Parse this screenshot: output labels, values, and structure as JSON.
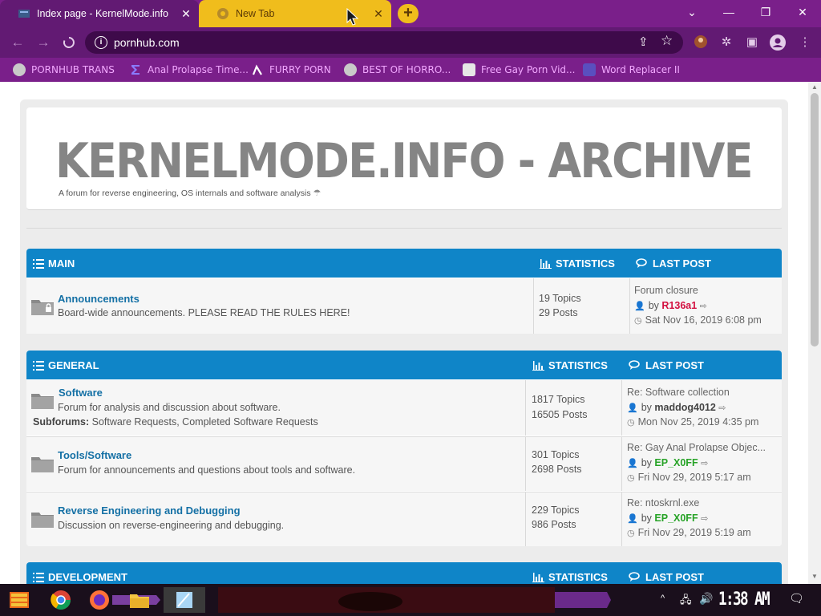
{
  "browser": {
    "tabs": [
      {
        "title": "Index page - KernelMode.info",
        "active": true
      },
      {
        "title": "New Tab",
        "active": false
      }
    ],
    "new_tab": "+",
    "window_controls": {
      "tab_search": "⌄",
      "minimize": "—",
      "restore": "❐",
      "close": "✕"
    },
    "url": "pornhub.com",
    "bookmarks": [
      "PORNHUB TRANS",
      "Anal Prolapse Time...",
      "FURRY PORN",
      "BEST OF HORRO...",
      "Free Gay Porn Vid...",
      "Word Replacer II"
    ],
    "colors": {
      "tabstrip": "#7a1f8a",
      "toolbar": "#621a73",
      "inactive_tab": "#f0bd1c",
      "bookmark_text": "#f2a8ff"
    }
  },
  "page": {
    "site_title": "KERNELMODE.INFO - ARCHIVE",
    "site_description": "A forum for reverse engineering, OS internals and software analysis",
    "accent_color": "#0f85c8",
    "categories": [
      {
        "name": "MAIN",
        "stats_header": "STATISTICS",
        "lastpost_header": "LAST POST",
        "forums": [
          {
            "title": "Announcements",
            "description": "Board-wide announcements. PLEASE READ THE RULES HERE!",
            "topics": "19 Topics",
            "posts": "29 Posts",
            "last_post": {
              "subject": "Forum closure",
              "by": "by",
              "user": "R136a1",
              "user_color": "#d31141",
              "date": "Sat Nov 16, 2019 6:08 pm"
            }
          }
        ]
      },
      {
        "name": "GENERAL",
        "stats_header": "STATISTICS",
        "lastpost_header": "LAST POST",
        "forums": [
          {
            "title": "Software",
            "description": "Forum for analysis and discussion about software.",
            "subforums_label": "Subforums:",
            "subforums": "Software Requests, Completed Software Requests",
            "topics": "1817 Topics",
            "posts": "16505 Posts",
            "last_post": {
              "subject": "Re: Software collection",
              "by": "by",
              "user": "maddog4012",
              "user_color": "#444444",
              "date": "Mon Nov 25, 2019 4:35 pm"
            }
          },
          {
            "title": "Tools/Software",
            "description": "Forum for announcements and questions about tools and software.",
            "topics": "301 Topics",
            "posts": "2698 Posts",
            "last_post": {
              "subject": "Re: Gay Anal Prolapse Objec...",
              "by": "by",
              "user": "EP_X0FF",
              "user_color": "#27a327",
              "date": "Fri Nov 29, 2019 5:17 am"
            }
          },
          {
            "title": "Reverse Engineering and Debugging",
            "description": "Discussion on reverse-engineering and debugging.",
            "topics": "229 Topics",
            "posts": "986 Posts",
            "last_post": {
              "subject": "Re: ntoskrnl.exe",
              "by": "by",
              "user": "EP_X0FF",
              "user_color": "#27a327",
              "date": "Fri Nov 29, 2019 5:19 am"
            }
          }
        ]
      },
      {
        "name": "DEVELOPMENT",
        "stats_header": "STATISTICS",
        "lastpost_header": "LAST POST",
        "forums": []
      }
    ]
  },
  "taskbar": {
    "clock": "1:38 AM"
  }
}
